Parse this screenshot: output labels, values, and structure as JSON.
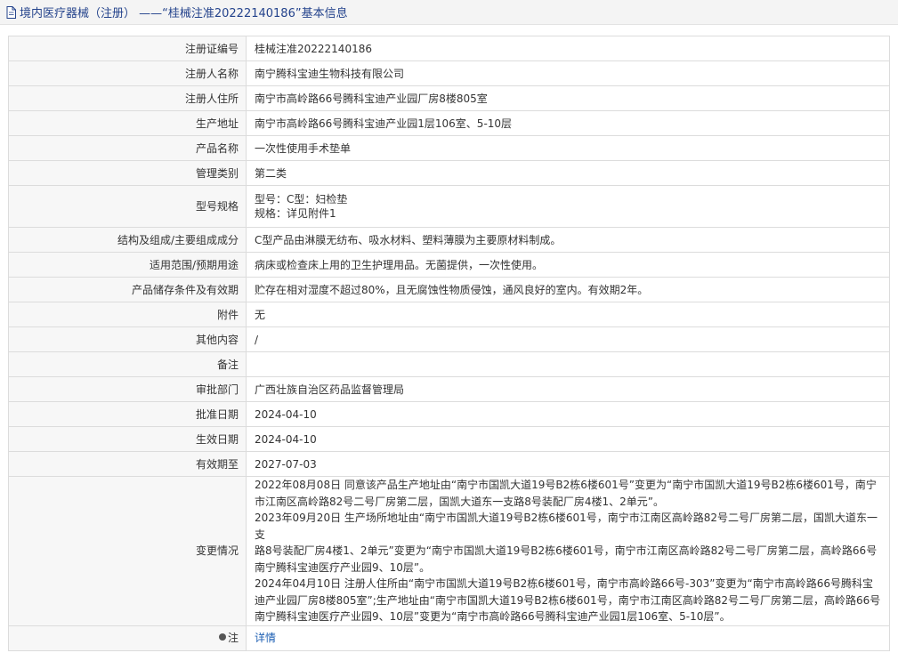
{
  "header": {
    "title": "境内医疗器械（注册） ——“桂械注准20222140186”基本信息",
    "icon": "document-icon"
  },
  "rows": {
    "reg_no": {
      "label": "注册证编号",
      "value": "桂械注准20222140186"
    },
    "registrant": {
      "label": "注册人名称",
      "value": "南宁腾科宝迪生物科技有限公司"
    },
    "registrant_addr": {
      "label": "注册人住所",
      "value": "南宁市高岭路66号腾科宝迪产业园厂房8楼805室"
    },
    "production_addr": {
      "label": "生产地址",
      "value": "南宁市高岭路66号腾科宝迪产业园1层106室、5-10层"
    },
    "product_name": {
      "label": "产品名称",
      "value": "一次性使用手术垫单"
    },
    "category": {
      "label": "管理类别",
      "value": "第二类"
    },
    "model": {
      "label": "型号规格",
      "line1": "型号：C型：妇检垫",
      "line2": "规格：详见附件1"
    },
    "structure": {
      "label": "结构及组成/主要组成成分",
      "value": "C型产品由淋膜无纺布、吸水材料、塑料薄膜为主要原材料制成。"
    },
    "scope": {
      "label": "适用范围/预期用途",
      "value": "病床或检查床上用的卫生护理用品。无菌提供，一次性使用。"
    },
    "storage": {
      "label": "产品储存条件及有效期",
      "value": "贮存在相对湿度不超过80%，且无腐蚀性物质侵蚀，通风良好的室内。有效期2年。"
    },
    "attachment": {
      "label": "附件",
      "value": "无"
    },
    "other": {
      "label": "其他内容",
      "value": "/"
    },
    "remark": {
      "label": "备注",
      "value": ""
    },
    "dept": {
      "label": "审批部门",
      "value": "广西壮族自治区药品监督管理局"
    },
    "approve_date": {
      "label": "批准日期",
      "value": "2024-04-10"
    },
    "effective_date": {
      "label": "生效日期",
      "value": "2024-04-10"
    },
    "expiry": {
      "label": "有效期至",
      "value": "2027-07-03"
    },
    "changes": {
      "label": "变更情况",
      "lines": [
        "2022年08月08日 同意该产品生产地址由“南宁市国凯大道19号B2栋6楼601号”变更为“南宁市国凯大道19号B2栋6楼601号，南宁",
        "市江南区高岭路82号二号厂房第二层，国凯大道东一支路8号装配厂房4楼1、2单元”。",
        "2023年09月20日 生产场所地址由“南宁市国凯大道19号B2栋6楼601号，南宁市江南区高岭路82号二号厂房第二层，国凯大道东一支",
        "路8号装配厂房4楼1、2单元”变更为“南宁市国凯大道19号B2栋6楼601号，南宁市江南区高岭路82号二号厂房第二层，高岭路66号",
        "南宁腾科宝迪医疗产业园9、10层”。",
        "2024年04月10日 注册人住所由“南宁市国凯大道19号B2栋6楼601号，南宁市高岭路66号-303”变更为“南宁市高岭路66号腾科宝",
        "迪产业园厂房8楼805室”;生产地址由“南宁市国凯大道19号B2栋6楼601号，南宁市江南区高岭路82号二号厂房第二层，高岭路66号",
        "南宁腾科宝迪医疗产业园9、10层”变更为“南宁市高岭路66号腾科宝迪产业园1层106室、5-10层”。"
      ]
    },
    "note": {
      "label": "注",
      "value": "详情",
      "icon": "info-dot-icon"
    }
  }
}
